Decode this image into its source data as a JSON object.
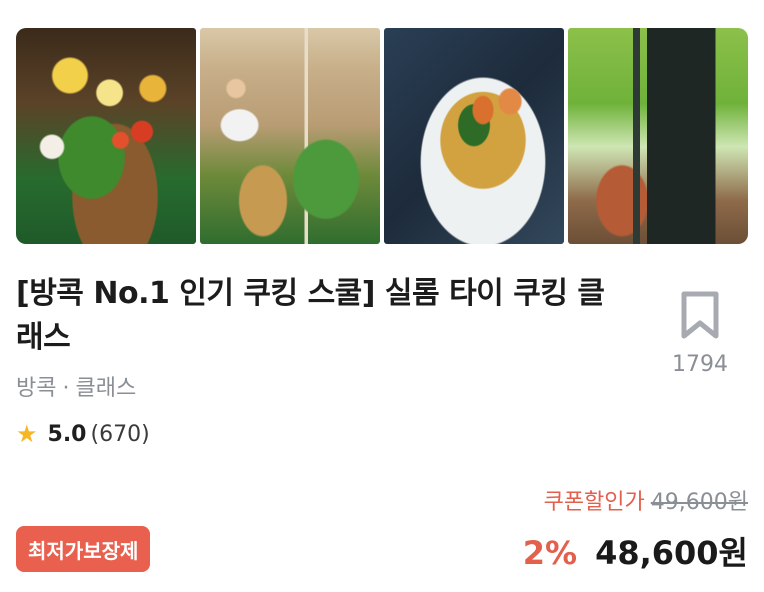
{
  "gallery": {
    "photos": [
      {
        "name": "photo-market-vegetables"
      },
      {
        "name": "photo-chef-kitchen"
      },
      {
        "name": "photo-tom-yum-soup"
      },
      {
        "name": "photo-restaurant-interior"
      }
    ]
  },
  "product": {
    "title": "[방콕 No.1 인기 쿠킹 스쿨] 실롬 타이 쿠킹 클래스",
    "location": "방콕",
    "separator": "·",
    "category": "클래스"
  },
  "bookmark": {
    "icon": "bookmark-icon",
    "count": "1794"
  },
  "rating": {
    "icon": "star-icon",
    "score": "5.0",
    "count": "(670)",
    "star_color": "#F6B626"
  },
  "pricing": {
    "coupon_label": "쿠폰할인가",
    "original_price": "49,600원",
    "discount_rate": "2%",
    "final_price": "48,600원",
    "accent_color": "#E3604D"
  },
  "badge": {
    "label": "최저가보장제",
    "color": "#E9604E"
  }
}
